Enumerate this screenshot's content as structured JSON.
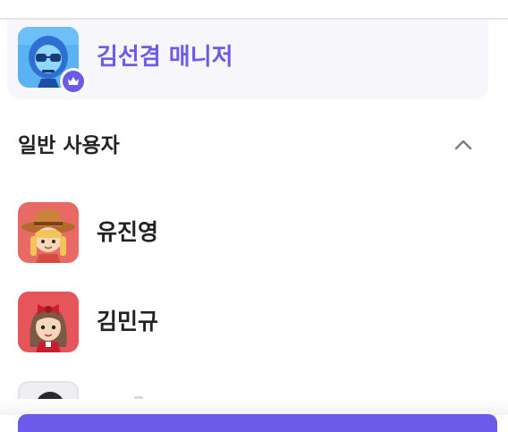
{
  "manager": {
    "name": "김선겸 매니저",
    "avatar_icon": "robot-avatar-icon",
    "badge_icon": "crown-icon"
  },
  "section": {
    "title": "일반 사용자",
    "toggle_icon": "chevron-up-icon"
  },
  "users": [
    {
      "name": "유진영",
      "avatar_icon": "cowboy-hat-avatar-icon"
    },
    {
      "name": "김민규",
      "avatar_icon": "bow-girl-avatar-icon"
    }
  ],
  "colors": {
    "accent": "#6b5bea",
    "card_bg": "#f7f7fb",
    "text": "#222222"
  }
}
